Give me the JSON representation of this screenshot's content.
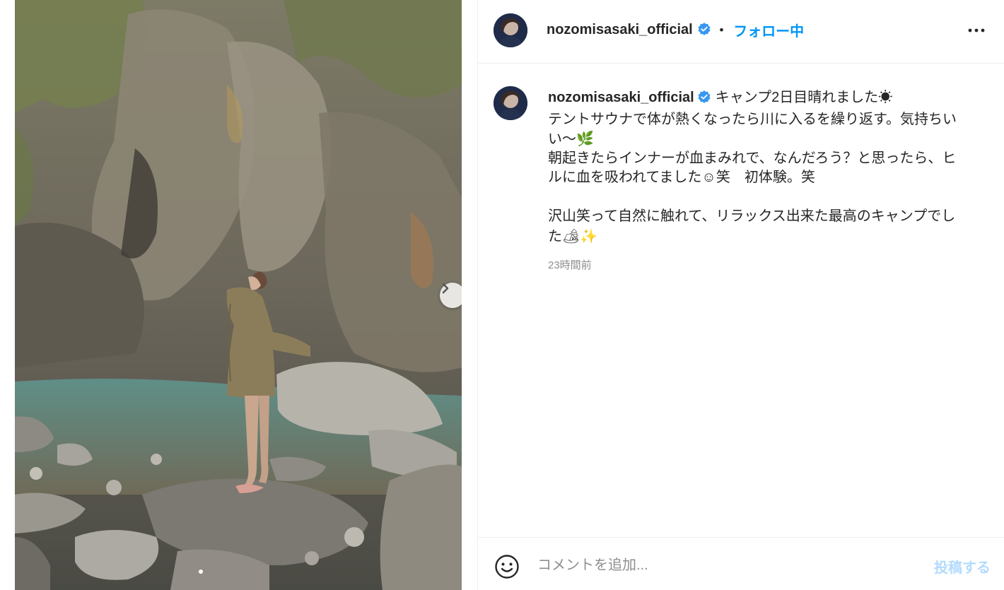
{
  "post": {
    "username": "nozomisasaki_official",
    "separator": "•",
    "follow_label": "フォロー中",
    "more_icon": "more-icon",
    "caption_lines": [
      "キャンプ2日目晴れました☀",
      "テントサウナで体が熱くなったら川に入るを繰り返す。気持ちい",
      "い〜🌿",
      "朝起きたらインナーが血まみれで、なんだろう？と思ったら、ヒ",
      "ルに血を吸われてました☺笑　初体験。笑",
      "",
      "沢山笑って自然に触れて、リラックス出来た最高のキャンプでし",
      "た🏕✨"
    ],
    "timestamp": "23時間前"
  },
  "carousel": {
    "image_description_icon": "photo",
    "next_icon": "chevron-right-icon",
    "current_index": 1,
    "total": 2
  },
  "comment": {
    "placeholder": "コメントを追加...",
    "post_label": "投稿する",
    "emoji_icon": "smile-icon"
  },
  "colors": {
    "accent": "#0095f6",
    "post_disabled": "#b3dbff",
    "verified": "#3897f0",
    "secondary_text": "#8e8e8e"
  }
}
